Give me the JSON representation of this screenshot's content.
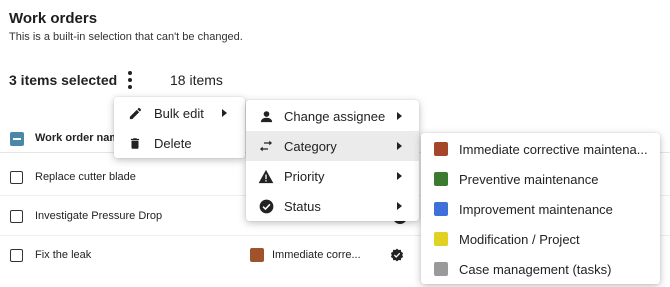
{
  "header": {
    "title": "Work orders",
    "subtitle": "This is a built-in selection that can't be changed."
  },
  "selection": {
    "selected_label": "3 items selected",
    "count_label": "18 items"
  },
  "table": {
    "column_header": "Work order nam",
    "rows": [
      {
        "name": "Replace cutter blade",
        "category": "",
        "checked": false
      },
      {
        "name": "Investigate Pressure Drop",
        "category": "",
        "checked": false
      },
      {
        "name": "Fix the leak",
        "category": "Immediate corre...",
        "category_color": "#a0522d",
        "checked": false
      }
    ]
  },
  "menu1": {
    "items": [
      {
        "label": "Bulk edit",
        "icon": "pencil-icon",
        "submenu": true
      },
      {
        "label": "Delete",
        "icon": "trash-icon",
        "submenu": false
      }
    ]
  },
  "menu2": {
    "items": [
      {
        "label": "Change assignee",
        "icon": "person-icon"
      },
      {
        "label": "Category",
        "icon": "swap-arrows-icon"
      },
      {
        "label": "Priority",
        "icon": "warning-icon"
      },
      {
        "label": "Status",
        "icon": "check-circle-icon"
      }
    ]
  },
  "menu3": {
    "items": [
      {
        "label": "Immediate corrective maintena...",
        "color": "#a5462b"
      },
      {
        "label": "Preventive maintenance",
        "color": "#3b7a2f"
      },
      {
        "label": "Improvement maintenance",
        "color": "#3f6fd8"
      },
      {
        "label": "Modification / Project",
        "color": "#e0d122"
      },
      {
        "label": "Case management (tasks)",
        "color": "#9a9a9a"
      }
    ]
  },
  "colors": {
    "accent": "#4a87a8",
    "highlight": "#ebebeb"
  }
}
